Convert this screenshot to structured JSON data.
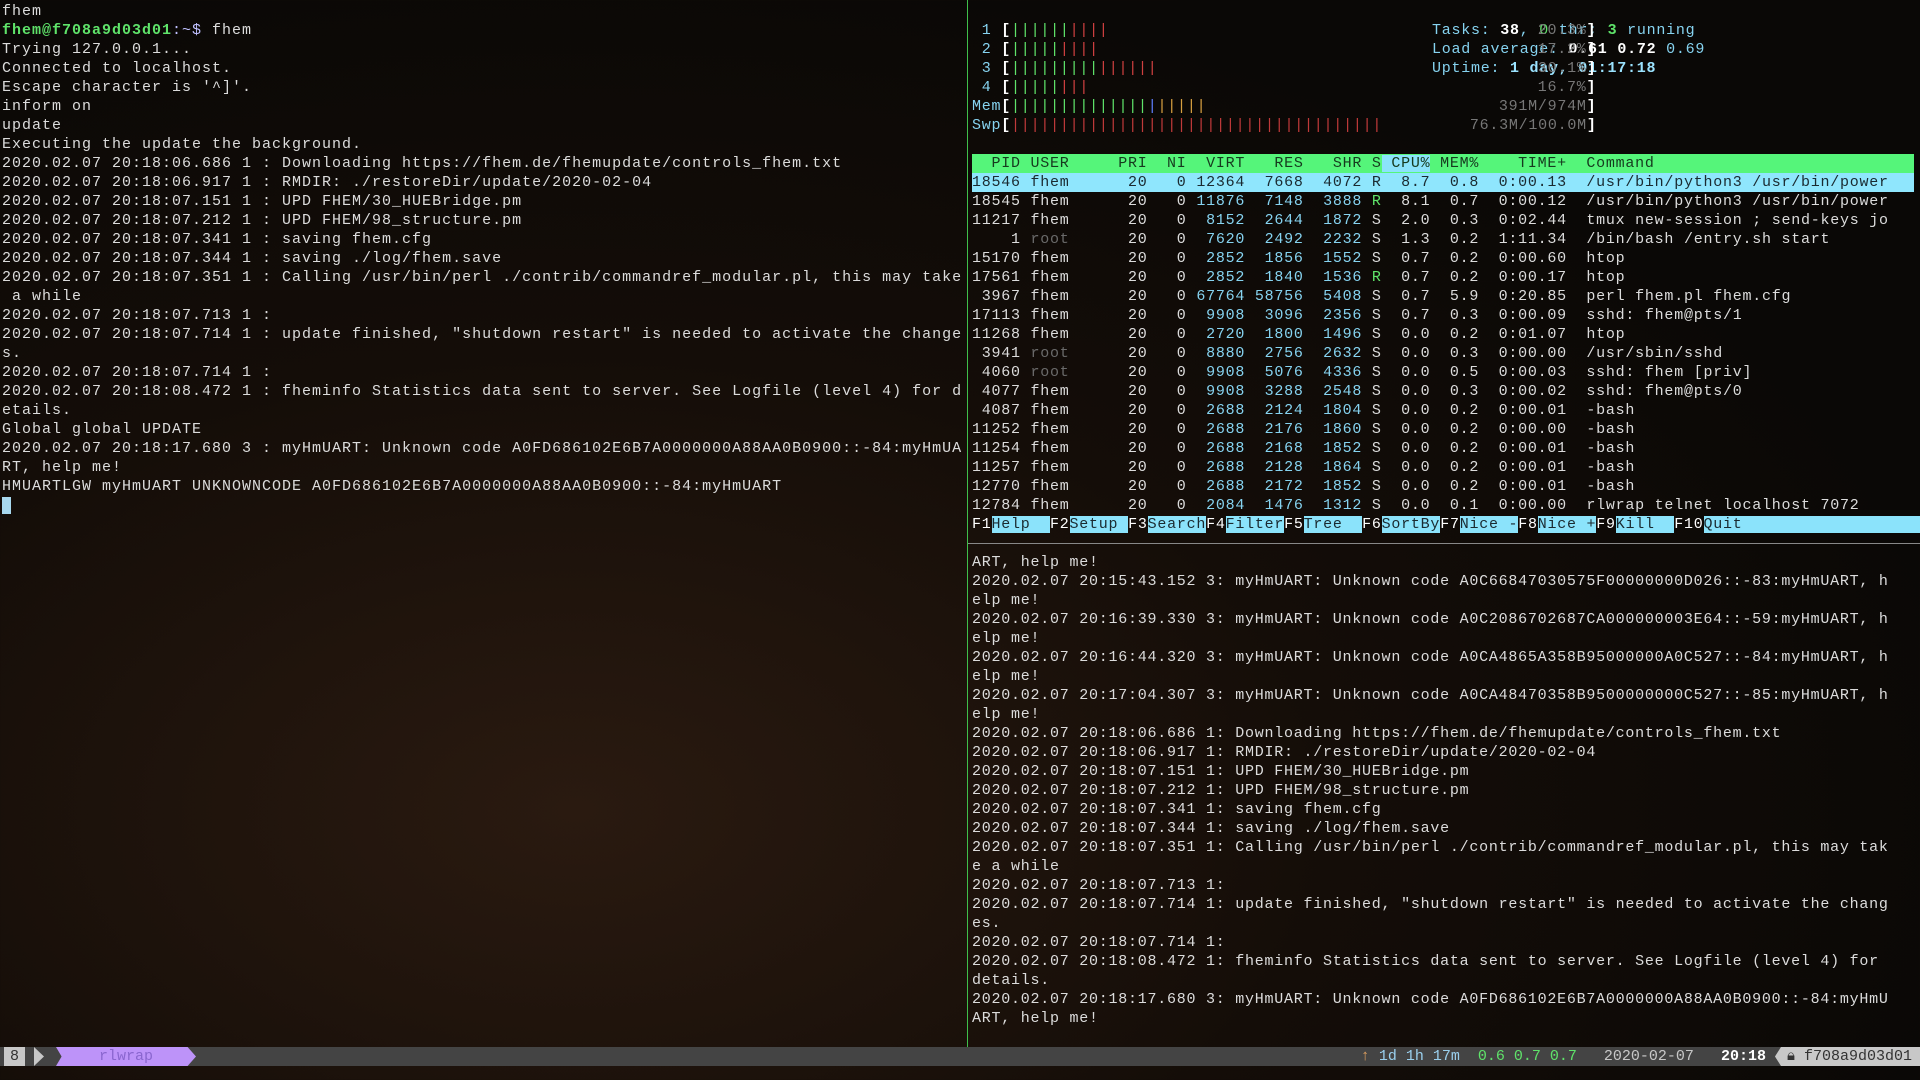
{
  "left_pane": {
    "first_line": "fhem",
    "prompt_user": "fhem@f708a9d03d01",
    "prompt_sep": ":~$",
    "prompt_cmd": " fhem",
    "lines": [
      "Trying 127.0.0.1...",
      "Connected to localhost.",
      "Escape character is '^]'.",
      "inform on",
      "update",
      "Executing the update the background.",
      "2020.02.07 20:18:06.686 1 : Downloading https://fhem.de/fhemupdate/controls_fhem.txt",
      "2020.02.07 20:18:06.917 1 : RMDIR: ./restoreDir/update/2020-02-04",
      "2020.02.07 20:18:07.151 1 : UPD FHEM/30_HUEBridge.pm",
      "2020.02.07 20:18:07.212 1 : UPD FHEM/98_structure.pm",
      "2020.02.07 20:18:07.341 1 : saving fhem.cfg",
      "2020.02.07 20:18:07.344 1 : saving ./log/fhem.save",
      "2020.02.07 20:18:07.351 1 : Calling /usr/bin/perl ./contrib/commandref_modular.pl, this may take",
      " a while",
      "2020.02.07 20:18:07.713 1 :",
      "2020.02.07 20:18:07.714 1 : update finished, \"shutdown restart\" is needed to activate the change",
      "s.",
      "2020.02.07 20:18:07.714 1 :",
      "2020.02.07 20:18:08.472 1 : fheminfo Statistics data sent to server. See Logfile (level 4) for d",
      "etails.",
      "Global global UPDATE",
      "2020.02.07 20:18:17.680 3 : myHmUART: Unknown code A0FD686102E6B7A0000000A88AA0B0900::-84:myHmUA",
      "RT, help me!",
      "HMUARTLGW myHmUART UNKNOWNCODE A0FD686102E6B7A0000000A88AA0B0900::-84:myHmUART"
    ]
  },
  "htop": {
    "cpus": [
      {
        "label": "1",
        "percent": 20.3,
        "text": "20.3%"
      },
      {
        "label": "2",
        "percent": 17.2,
        "text": "17.2%"
      },
      {
        "label": "3",
        "percent": 30.1,
        "text": "30.1%"
      },
      {
        "label": "4",
        "percent": 16.7,
        "text": "16.7%"
      }
    ],
    "mem": {
      "label": "Mem",
      "used_fraction": 0.401,
      "text": "391M/974M"
    },
    "swp": {
      "label": "Swp",
      "used_fraction": 0.763,
      "text": "76.3M/100.0M"
    },
    "tasks": {
      "label": "Tasks: ",
      "count": "38",
      "thr": "0",
      "thr_label": " thr; ",
      "running": "3",
      "running_label": " running"
    },
    "load": {
      "label": "Load average: ",
      "l1": "0.61",
      "l5": "0.72",
      "l15": "0.69"
    },
    "uptime": {
      "label": "Uptime: ",
      "value": "1 day, 01:17:18"
    },
    "columns": [
      "PID",
      "USER",
      "PRI",
      "NI",
      "VIRT",
      "RES",
      "SHR",
      "S",
      "CPU%",
      "MEM%",
      "TIME+",
      "Command"
    ],
    "sort_column": "CPU%",
    "processes": [
      [
        "18546",
        "fhem",
        "20",
        "0",
        "12364",
        "7668",
        "4072",
        "R",
        "8.7",
        "0.8",
        "0:00.13",
        "/usr/bin/python3 /usr/bin/power"
      ],
      [
        "18545",
        "fhem",
        "20",
        "0",
        "11876",
        "7148",
        "3888",
        "R",
        "8.1",
        "0.7",
        "0:00.12",
        "/usr/bin/python3 /usr/bin/power"
      ],
      [
        "11217",
        "fhem",
        "20",
        "0",
        "8152",
        "2644",
        "1872",
        "S",
        "2.0",
        "0.3",
        "0:02.44",
        "tmux new-session ; send-keys jo"
      ],
      [
        "1",
        "root",
        "20",
        "0",
        "7620",
        "2492",
        "2232",
        "S",
        "1.3",
        "0.2",
        "1:11.34",
        "/bin/bash /entry.sh start"
      ],
      [
        "15170",
        "fhem",
        "20",
        "0",
        "2852",
        "1856",
        "1552",
        "S",
        "0.7",
        "0.2",
        "0:00.60",
        "htop"
      ],
      [
        "17561",
        "fhem",
        "20",
        "0",
        "2852",
        "1840",
        "1536",
        "R",
        "0.7",
        "0.2",
        "0:00.17",
        "htop"
      ],
      [
        "3967",
        "fhem",
        "20",
        "0",
        "67764",
        "58756",
        "5408",
        "S",
        "0.7",
        "5.9",
        "0:20.85",
        "perl fhem.pl fhem.cfg"
      ],
      [
        "17113",
        "fhem",
        "20",
        "0",
        "9908",
        "3096",
        "2356",
        "S",
        "0.7",
        "0.3",
        "0:00.09",
        "sshd: fhem@pts/1"
      ],
      [
        "11268",
        "fhem",
        "20",
        "0",
        "2720",
        "1800",
        "1496",
        "S",
        "0.0",
        "0.2",
        "0:01.07",
        "htop"
      ],
      [
        "3941",
        "root",
        "20",
        "0",
        "8880",
        "2756",
        "2632",
        "S",
        "0.0",
        "0.3",
        "0:00.00",
        "/usr/sbin/sshd"
      ],
      [
        "4060",
        "root",
        "20",
        "0",
        "9908",
        "5076",
        "4336",
        "S",
        "0.0",
        "0.5",
        "0:00.03",
        "sshd: fhem [priv]"
      ],
      [
        "4077",
        "fhem",
        "20",
        "0",
        "9908",
        "3288",
        "2548",
        "S",
        "0.0",
        "0.3",
        "0:00.02",
        "sshd: fhem@pts/0"
      ],
      [
        "4087",
        "fhem",
        "20",
        "0",
        "2688",
        "2124",
        "1804",
        "S",
        "0.0",
        "0.2",
        "0:00.01",
        "-bash"
      ],
      [
        "11252",
        "fhem",
        "20",
        "0",
        "2688",
        "2176",
        "1860",
        "S",
        "0.0",
        "0.2",
        "0:00.00",
        "-bash"
      ],
      [
        "11254",
        "fhem",
        "20",
        "0",
        "2688",
        "2168",
        "1852",
        "S",
        "0.0",
        "0.2",
        "0:00.01",
        "-bash"
      ],
      [
        "11257",
        "fhem",
        "20",
        "0",
        "2688",
        "2128",
        "1864",
        "S",
        "0.0",
        "0.2",
        "0:00.01",
        "-bash"
      ],
      [
        "12770",
        "fhem",
        "20",
        "0",
        "2688",
        "2172",
        "1852",
        "S",
        "0.0",
        "0.2",
        "0:00.01",
        "-bash"
      ],
      [
        "12784",
        "fhem",
        "20",
        "0",
        "2084",
        "1476",
        "1312",
        "S",
        "0.0",
        "0.1",
        "0:00.00",
        "rlwrap telnet localhost 7072"
      ]
    ],
    "fkeys": [
      {
        "key": "F1",
        "label": "Help  "
      },
      {
        "key": "F2",
        "label": "Setup "
      },
      {
        "key": "F3",
        "label": "Search"
      },
      {
        "key": "F4",
        "label": "Filter"
      },
      {
        "key": "F5",
        "label": "Tree  "
      },
      {
        "key": "F6",
        "label": "SortBy"
      },
      {
        "key": "F7",
        "label": "Nice -"
      },
      {
        "key": "F8",
        "label": "Nice +"
      },
      {
        "key": "F9",
        "label": "Kill  "
      },
      {
        "key": "F10",
        "label": "Quit  "
      }
    ]
  },
  "log_pane": {
    "lines": [
      "ART, help me!",
      "2020.02.07 20:15:43.152 3: myHmUART: Unknown code A0C66847030575F00000000D026::-83:myHmUART, h",
      "elp me!",
      "2020.02.07 20:16:39.330 3: myHmUART: Unknown code A0C2086702687CA000000003E64::-59:myHmUART, h",
      "elp me!",
      "2020.02.07 20:16:44.320 3: myHmUART: Unknown code A0CA4865A358B95000000A0C527::-84:myHmUART, h",
      "elp me!",
      "2020.02.07 20:17:04.307 3: myHmUART: Unknown code A0CA48470358B9500000000C527::-85:myHmUART, h",
      "elp me!",
      "2020.02.07 20:18:06.686 1: Downloading https://fhem.de/fhemupdate/controls_fhem.txt",
      "2020.02.07 20:18:06.917 1: RMDIR: ./restoreDir/update/2020-02-04",
      "2020.02.07 20:18:07.151 1: UPD FHEM/30_HUEBridge.pm",
      "2020.02.07 20:18:07.212 1: UPD FHEM/98_structure.pm",
      "2020.02.07 20:18:07.341 1: saving fhem.cfg",
      "2020.02.07 20:18:07.344 1: saving ./log/fhem.save",
      "2020.02.07 20:18:07.351 1: Calling /usr/bin/perl ./contrib/commandref_modular.pl, this may tak",
      "e a while",
      "2020.02.07 20:18:07.713 1:",
      "2020.02.07 20:18:07.714 1: update finished, \"shutdown restart\" is needed to activate the chang",
      "es.",
      "2020.02.07 20:18:07.714 1:",
      "2020.02.07 20:18:08.472 1: fheminfo Statistics data sent to server. See Logfile (level 4) for",
      "details.",
      "2020.02.07 20:18:17.680 3: myHmUART: Unknown code A0FD686102E6B7A0000000A88AA0B0900::-84:myHmU",
      "ART, help me!"
    ]
  },
  "status_bar": {
    "window_index": "8",
    "window_name": "rlwrap",
    "uptime_icon": "up-arrow-icon",
    "uptime": "1d 1h 17m",
    "load": "0.6 0.7 0.7",
    "date": "2020-02-07",
    "time": "20:18",
    "lock_icon": "lock-icon",
    "hostname": "f708a9d03d01"
  },
  "colors": {
    "prompt": "#5fe36a",
    "htop_header": "#55f57a",
    "htop_selected": "#8fe6fd",
    "tmux_window": "#bd93f9"
  }
}
